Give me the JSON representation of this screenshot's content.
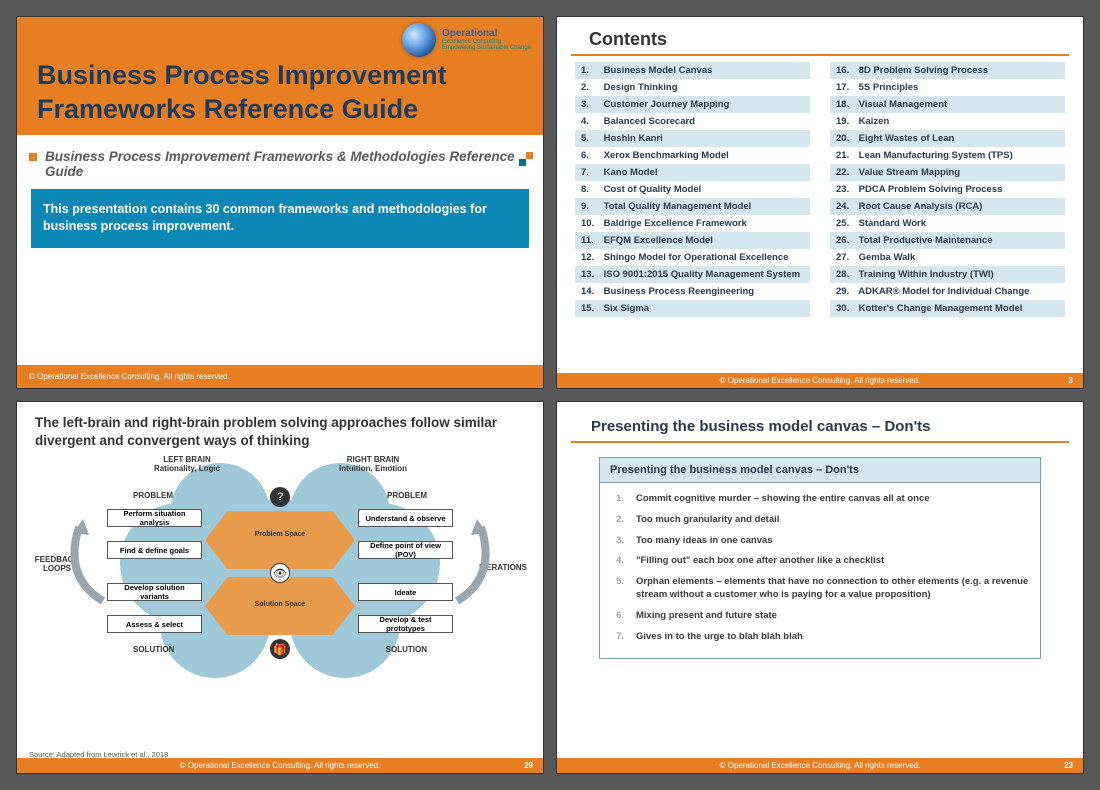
{
  "logo": {
    "name": "Operational",
    "sub": "Excellence Consulting",
    "tag": "Empowering Sustainable Change"
  },
  "footer_copyright": "© Operational Excellence Consulting.  All rights reserved.",
  "slide1": {
    "title": "Business Process Improvement Frameworks Reference Guide",
    "subtitle": "Business Process Improvement Frameworks & Methodologies Reference Guide",
    "blurb": "This presentation contains 30 common frameworks and methodologies for business process improvement."
  },
  "slide2": {
    "heading": "Contents",
    "page": "3",
    "left": [
      {
        "n": "1.",
        "t": "Business Model Canvas"
      },
      {
        "n": "2.",
        "t": "Design Thinking"
      },
      {
        "n": "3.",
        "t": "Customer Journey Mapping"
      },
      {
        "n": "4.",
        "t": "Balanced Scorecard"
      },
      {
        "n": "5.",
        "t": "Hoshin Kanri"
      },
      {
        "n": "6.",
        "t": "Xerox Benchmarking Model"
      },
      {
        "n": "7.",
        "t": "Kano Model"
      },
      {
        "n": "8.",
        "t": "Cost of Quality Model"
      },
      {
        "n": "9.",
        "t": "Total Quality Management Model"
      },
      {
        "n": "10.",
        "t": "Baldrige Excellence Framework"
      },
      {
        "n": "11.",
        "t": "EFQM Excellence Model"
      },
      {
        "n": "12.",
        "t": "Shingo Model for Operational Excellence"
      },
      {
        "n": "13.",
        "t": "ISO 9001:2015 Quality Management System"
      },
      {
        "n": "14.",
        "t": "Business Process Reengineering"
      },
      {
        "n": "15.",
        "t": "Six Sigma"
      }
    ],
    "right": [
      {
        "n": "16.",
        "t": "8D Problem Solving Process"
      },
      {
        "n": "17.",
        "t": "5S Principles"
      },
      {
        "n": "18.",
        "t": "Visual Management"
      },
      {
        "n": "19.",
        "t": "Kaizen"
      },
      {
        "n": "20.",
        "t": "Eight Wastes of Lean"
      },
      {
        "n": "21.",
        "t": "Lean Manufacturing System (TPS)"
      },
      {
        "n": "22.",
        "t": "Value Stream Mapping"
      },
      {
        "n": "23.",
        "t": "PDCA Problem Solving Process"
      },
      {
        "n": "24.",
        "t": "Root Cause Analysis (RCA)"
      },
      {
        "n": "25.",
        "t": "Standard Work"
      },
      {
        "n": "26.",
        "t": "Total Productive Maintenance"
      },
      {
        "n": "27.",
        "t": "Gemba Walk"
      },
      {
        "n": "28.",
        "t": "Training Within Industry (TWI)"
      },
      {
        "n": "29.",
        "t": "ADKAR® Model for Individual Change"
      },
      {
        "n": "30.",
        "t": "Kotter's Change Management Model"
      }
    ]
  },
  "slide3": {
    "heading": "The left-brain and right-brain problem solving approaches follow similar divergent and convergent ways of thinking",
    "page": "29",
    "left_brain_h": "LEFT BRAIN",
    "left_brain_s": "Rationality, Logic",
    "right_brain_h": "RIGHT BRAIN",
    "right_brain_s": "Intuition, Emotion",
    "problem_l": "PROBLEM",
    "problem_r": "PROBLEM",
    "solution_l": "SOLUTION",
    "solution_r": "SOLUTION",
    "problem_space": "Problem Space",
    "solution_space": "Solution Space",
    "feedback": "FEEDBACK LOOPS",
    "iterations": "ITERATIONS",
    "left_boxes": [
      "Perform situation analysis",
      "Find & define goals",
      "Develop solution variants",
      "Assess & select"
    ],
    "right_boxes": [
      "Understand & observe",
      "Define point of view (POV)",
      "Ideate",
      "Develop & test prototypes"
    ],
    "source": "Source: Adapted from Lewrick et al., 2018"
  },
  "slide4": {
    "heading": "Presenting the business model canvas – Don'ts",
    "box_heading": "Presenting the business model canvas – Don'ts",
    "page": "23",
    "items": [
      {
        "n": "1.",
        "t": "Commit cognitive murder – showing the entire canvas all at once"
      },
      {
        "n": "2.",
        "t": "Too much granularity and detail"
      },
      {
        "n": "3.",
        "t": "Too many ideas in one canvas"
      },
      {
        "n": "4.",
        "t": "\"Filling out\" each box one after another like a checklist"
      },
      {
        "n": "5.",
        "t": "Orphan elements – elements that have no connection to other elements (e.g. a revenue stream without a customer who is paying for a value proposition)"
      },
      {
        "n": "6.",
        "t": "Mixing present and future state"
      },
      {
        "n": "7.",
        "t": "Gives in to the urge to blah blah blah"
      }
    ]
  }
}
